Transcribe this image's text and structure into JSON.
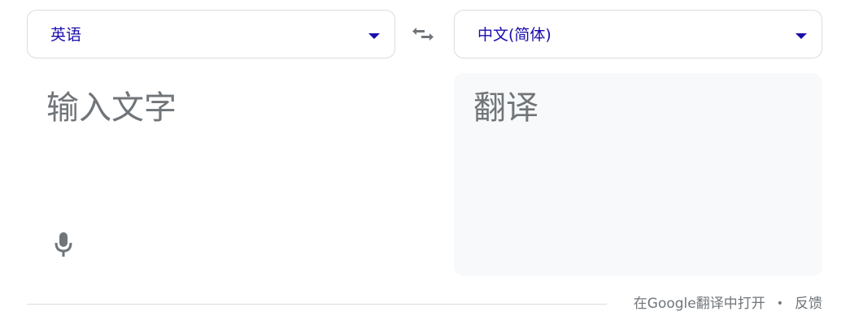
{
  "source_language": {
    "label": "英语"
  },
  "target_language": {
    "label": "中文(简体)"
  },
  "source_input": {
    "value": "",
    "placeholder": "输入文字"
  },
  "translation_output": {
    "text": "翻译"
  },
  "footer": {
    "open_in_translate": "在Google翻译中打开",
    "separator": "•",
    "feedback": "反馈"
  },
  "icons": {
    "dropdown": "chevron-down-icon",
    "swap": "swap-arrows-icon",
    "microphone": "microphone-icon"
  },
  "colors": {
    "language_label": "#1a0dab",
    "placeholder_text": "#70757a",
    "icon_gray": "#70757a",
    "output_background": "#f8f9fa",
    "border": "#dadce0"
  }
}
